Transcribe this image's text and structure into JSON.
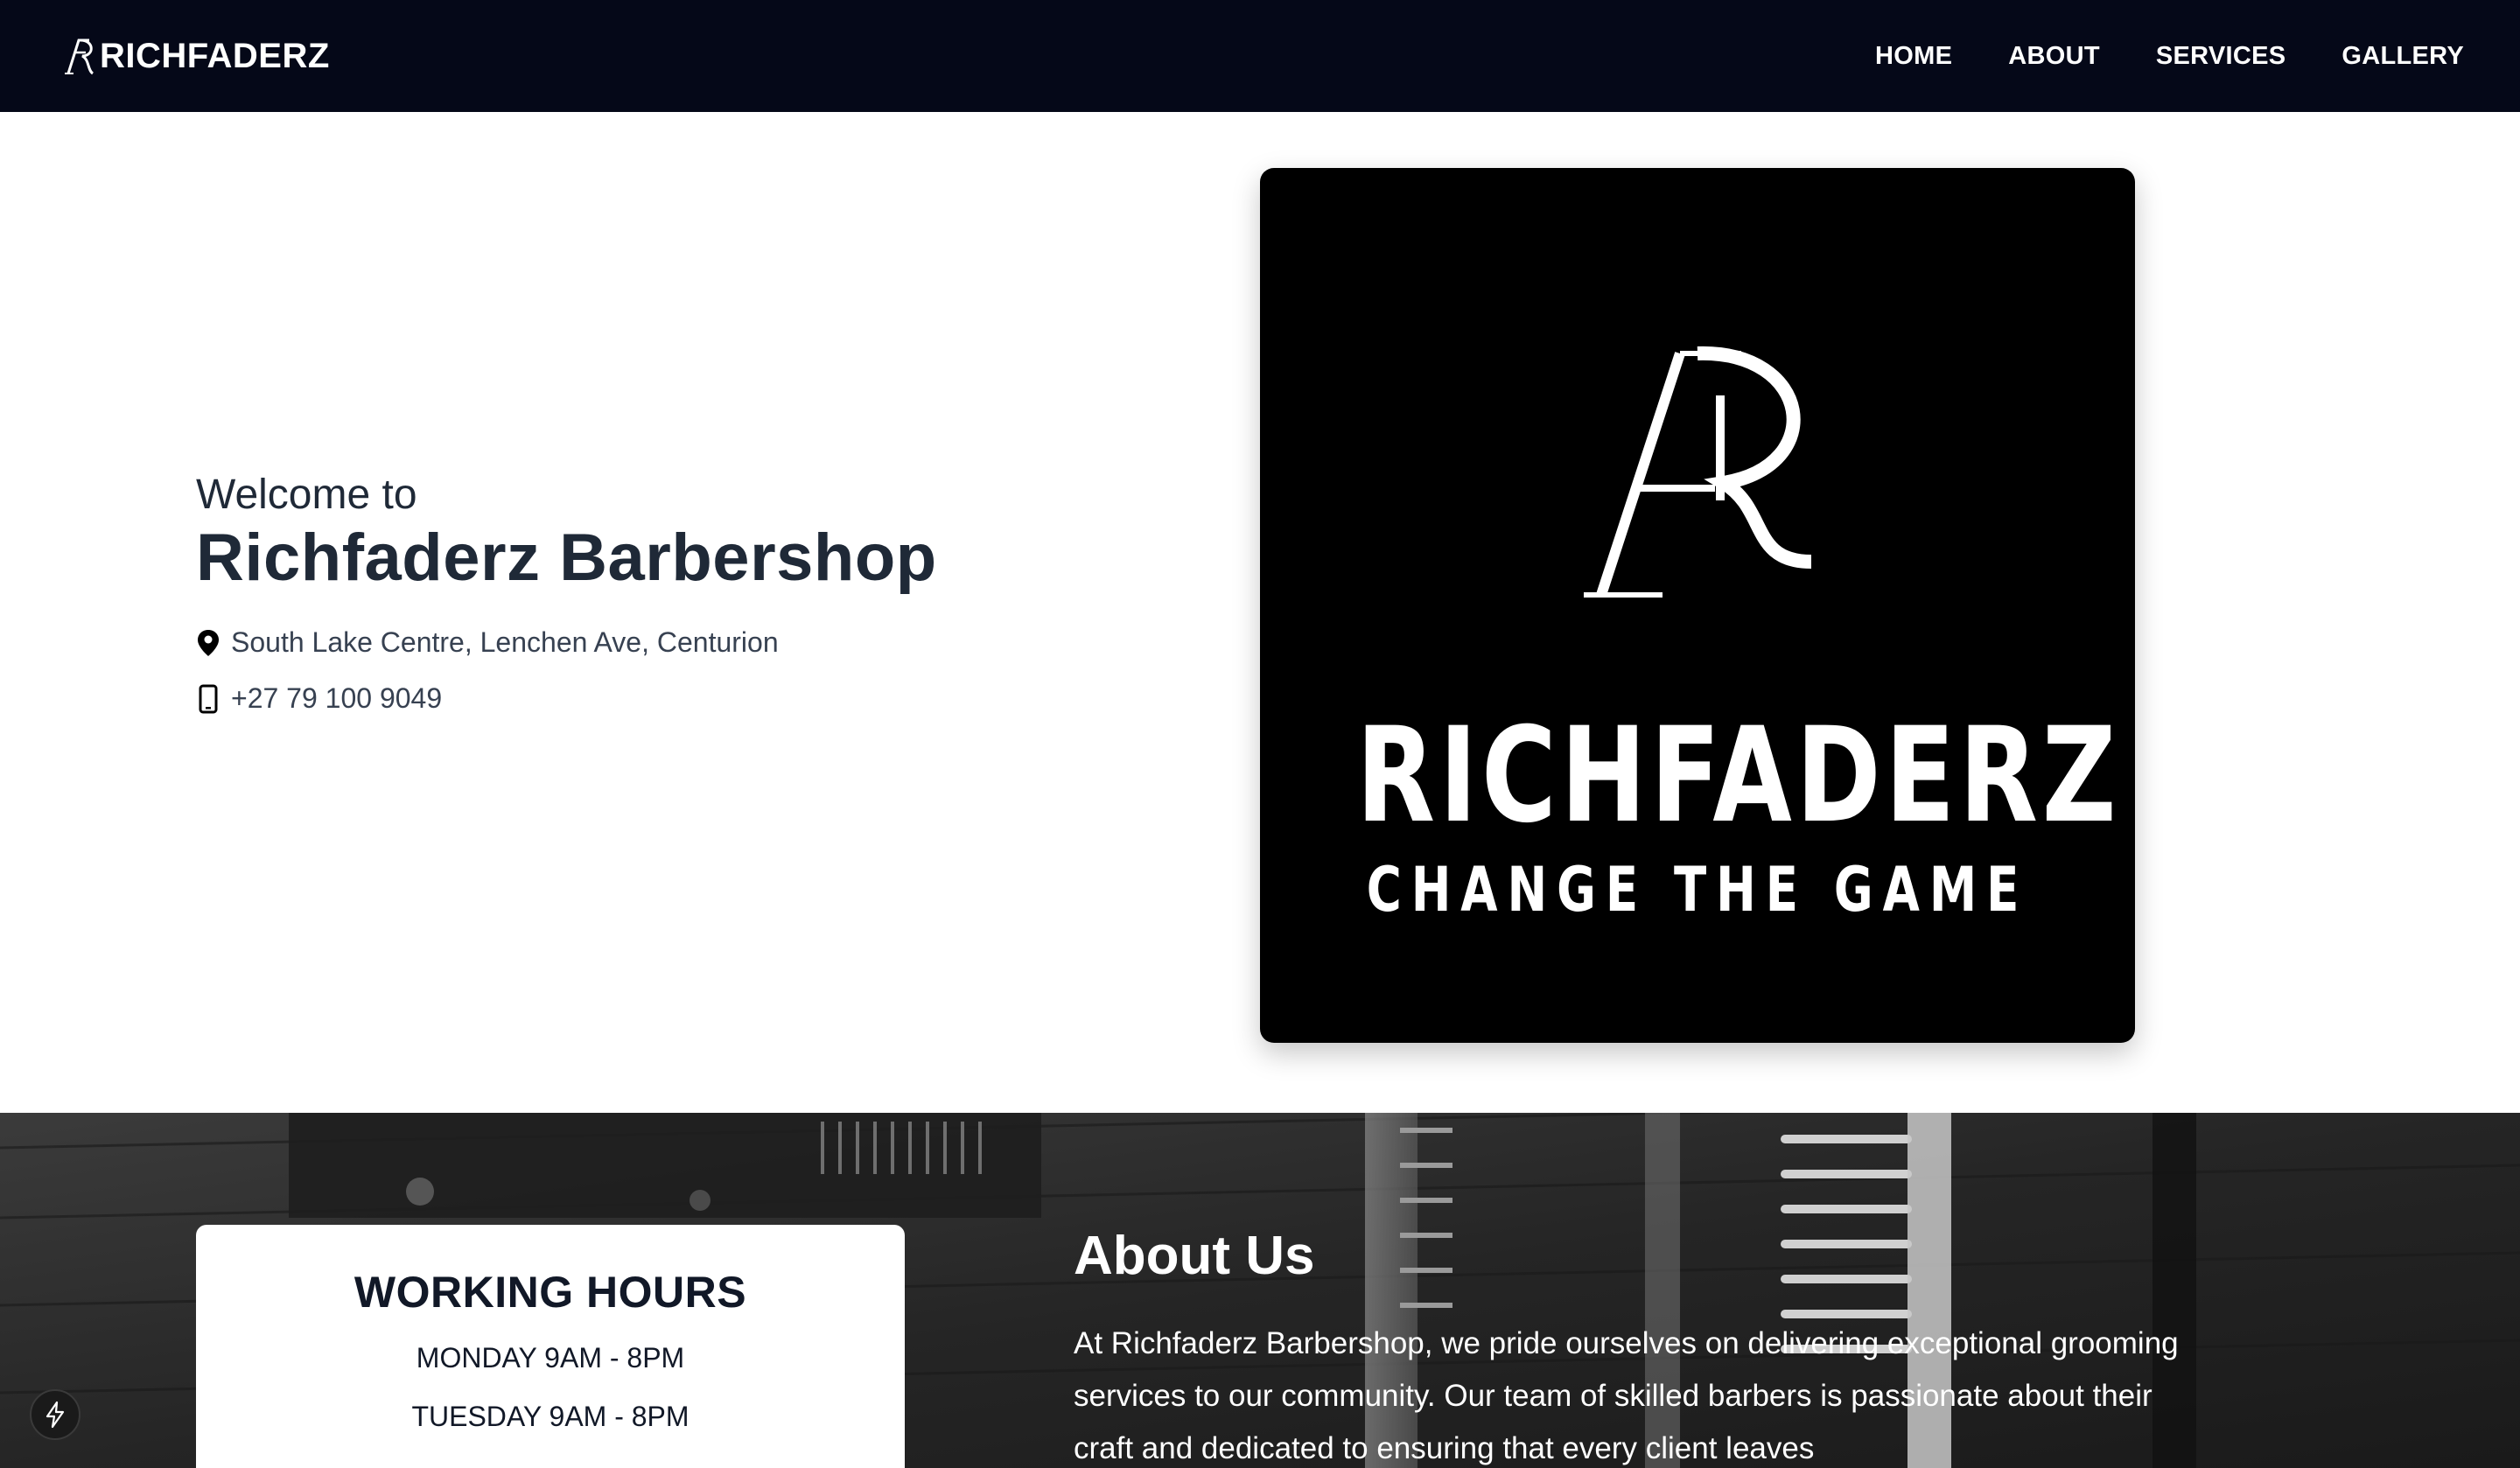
{
  "navbar": {
    "brand_mark_icon": "fr-monogram-icon",
    "brand_name": "RICHFADERZ",
    "links": [
      {
        "label": "HOME"
      },
      {
        "label": "ABOUT"
      },
      {
        "label": "SERVICES"
      },
      {
        "label": "GALLERY"
      }
    ]
  },
  "hero": {
    "welcome": "Welcome to",
    "title": "Richfaderz Barbershop",
    "address": {
      "icon": "location-pin-icon",
      "text": "South Lake Centre, Lenchen Ave, Centurion"
    },
    "phone": {
      "icon": "mobile-phone-icon",
      "text": "+27 79 100 9049"
    },
    "logo": {
      "monogram_icon": "fr-monogram-icon",
      "wordmark": "RICHFADERZ",
      "tagline": "CHANGE THE GAME"
    }
  },
  "working_hours": {
    "title": "WORKING HOURS",
    "items": [
      "MONDAY 9AM - 8PM",
      "TUESDAY 9AM - 8PM"
    ]
  },
  "about": {
    "title": "About Us",
    "text": "At Richfaderz Barbershop, we pride ourselves on delivering exceptional grooming services to our community. Our team of skilled barbers is passionate about their craft and dedicated to ensuring that every client leaves"
  },
  "dev_badge": {
    "icon": "lightning-icon"
  },
  "colors": {
    "navbar_bg": "#050818",
    "heading": "#1f2937",
    "body_text": "#374151",
    "logo_bg": "#000000",
    "white": "#ffffff"
  }
}
